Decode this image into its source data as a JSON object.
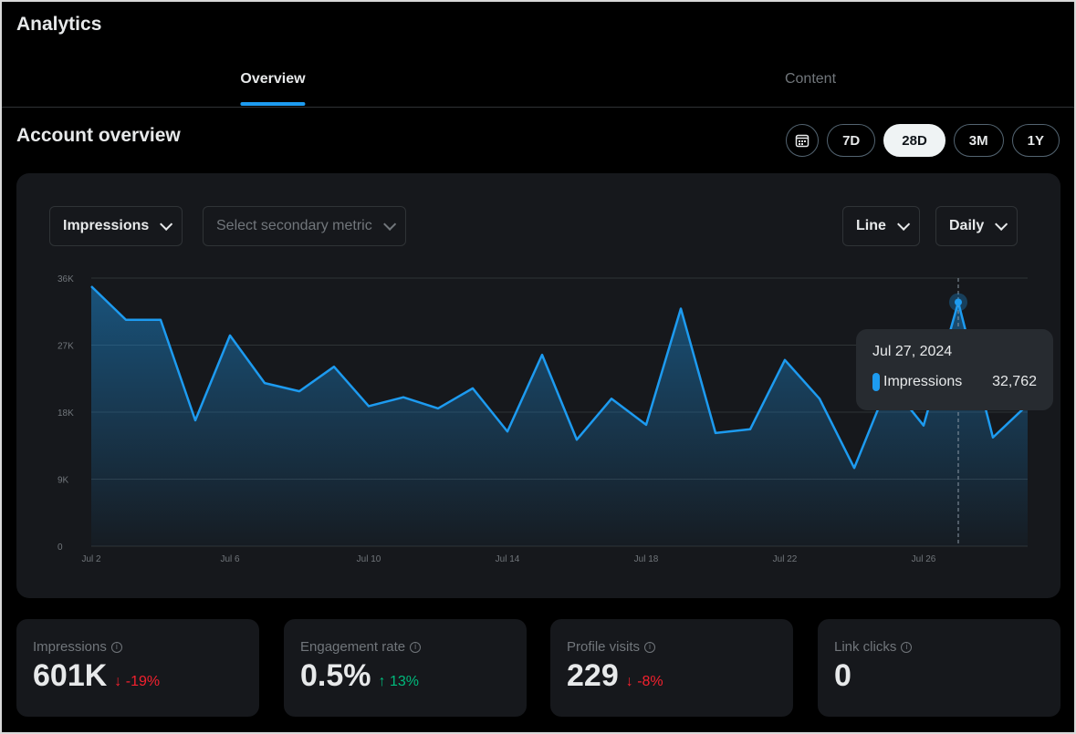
{
  "header": {
    "title": "Analytics"
  },
  "tabs": [
    {
      "label": "Overview",
      "active": true
    },
    {
      "label": "Content",
      "active": false
    }
  ],
  "section_title": "Account overview",
  "ranges": {
    "calendar_icon": "calendar-icon",
    "options": [
      "7D",
      "28D",
      "3M",
      "1Y"
    ],
    "selected": "28D"
  },
  "controls": {
    "primary_metric": "Impressions",
    "secondary_placeholder": "Select secondary metric",
    "chart_type": "Line",
    "interval": "Daily"
  },
  "colors": {
    "accent": "#1d9bf0",
    "negative": "#f4212e",
    "positive": "#00ba7c"
  },
  "chart_data": {
    "type": "area",
    "x": [
      "Jul 2",
      "Jul 3",
      "Jul 4",
      "Jul 5",
      "Jul 6",
      "Jul 7",
      "Jul 8",
      "Jul 9",
      "Jul 10",
      "Jul 11",
      "Jul 12",
      "Jul 13",
      "Jul 14",
      "Jul 15",
      "Jul 16",
      "Jul 17",
      "Jul 18",
      "Jul 19",
      "Jul 20",
      "Jul 21",
      "Jul 22",
      "Jul 23",
      "Jul 24",
      "Jul 25",
      "Jul 26",
      "Jul 27",
      "Jul 28",
      "Jul 29"
    ],
    "series": [
      {
        "name": "Impressions",
        "values": [
          34900,
          30400,
          30400,
          16900,
          28300,
          21900,
          20800,
          24100,
          18800,
          20000,
          18500,
          21200,
          15400,
          25700,
          14300,
          19800,
          16300,
          31900,
          15200,
          15700,
          25000,
          19800,
          10500,
          22000,
          16200,
          32762,
          14600,
          19000
        ]
      }
    ],
    "xticks": [
      "Jul 2",
      "Jul 6",
      "Jul 10",
      "Jul 14",
      "Jul 18",
      "Jul 22",
      "Jul 26"
    ],
    "yticks": [
      "0",
      "9K",
      "18K",
      "27K",
      "36K"
    ],
    "ylim": [
      0,
      36000
    ],
    "grid": true,
    "tooltip": {
      "date": "Jul 27, 2024",
      "series": "Impressions",
      "value": "32,762",
      "index": 25
    }
  },
  "cards": [
    {
      "label": "Impressions",
      "value": "601K",
      "change": "-19%",
      "dir": "down"
    },
    {
      "label": "Engagement rate",
      "value": "0.5%",
      "change": "13%",
      "dir": "up"
    },
    {
      "label": "Profile visits",
      "value": "229",
      "change": "-8%",
      "dir": "down"
    },
    {
      "label": "Link clicks",
      "value": "0",
      "change": "",
      "dir": ""
    }
  ]
}
